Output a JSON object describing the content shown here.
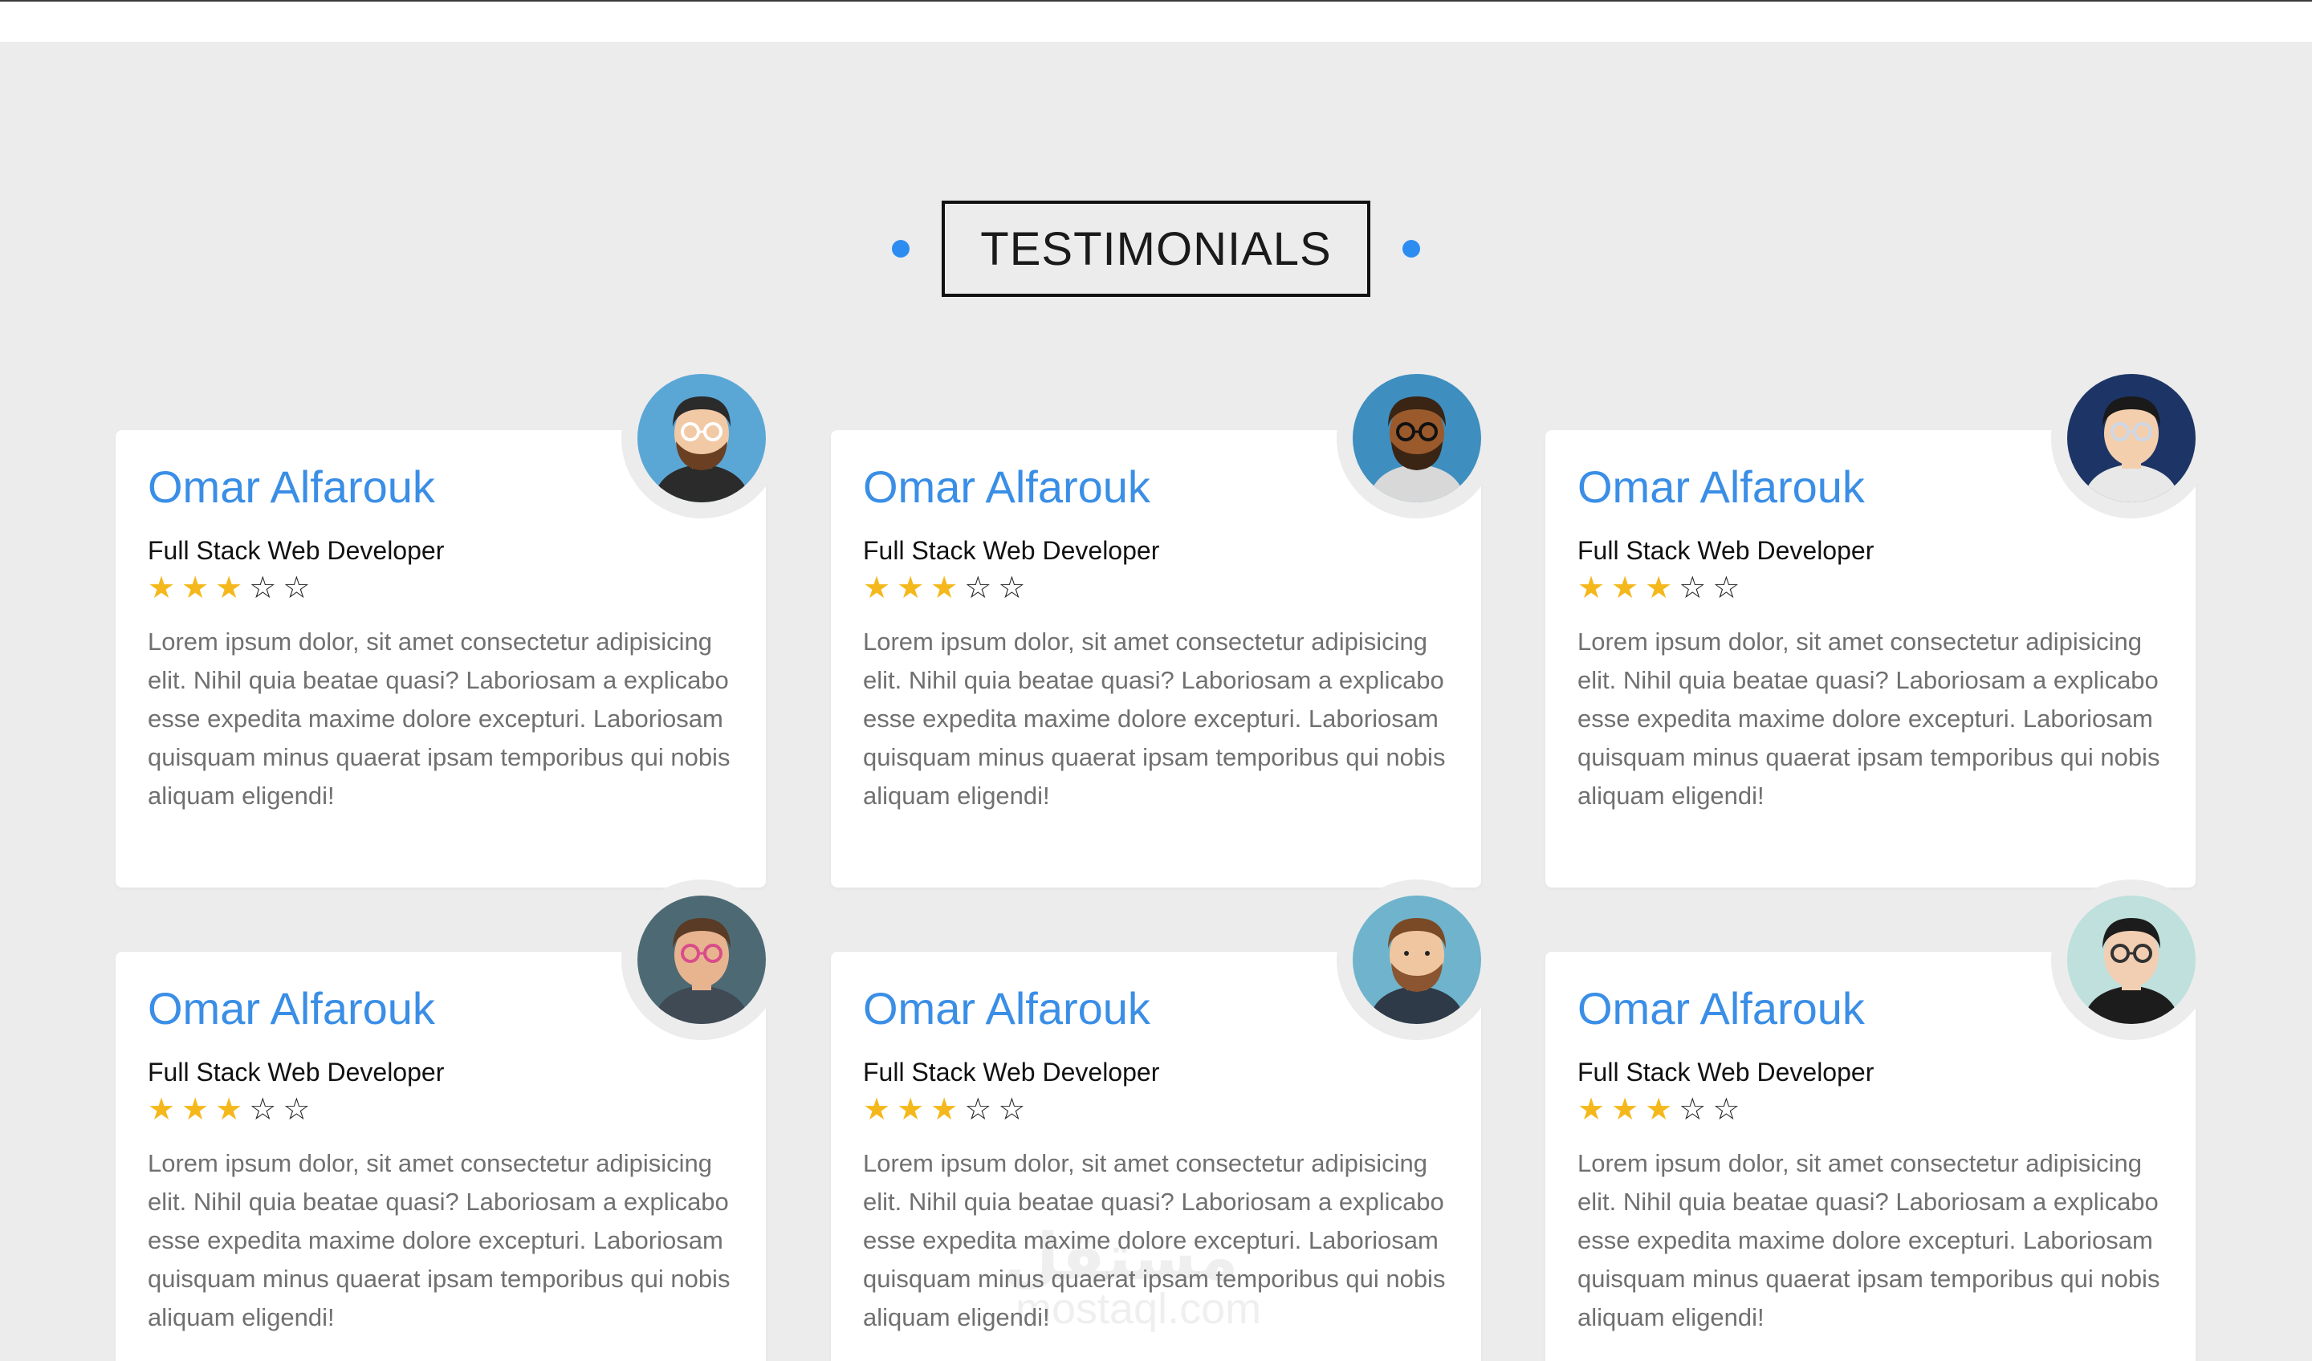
{
  "section": {
    "title": "TESTIMONIALS"
  },
  "colors": {
    "accent": "#2d8cf0",
    "name": "#3a8ee6",
    "star": "#f5b81c",
    "background": "#ececec"
  },
  "cards": [
    {
      "name": "Omar Alfarouk",
      "role": "Full Stack Web Developer",
      "rating": 3,
      "rating_max": 5,
      "text": "Lorem ipsum dolor, sit amet consectetur adipisicing elit. Nihil quia beatae quasi? Laboriosam a explicabo esse expedita maxime dolore excepturi. Laboriosam quisquam minus quaerat ipsam temporibus qui nobis aliquam eligendi!",
      "avatar": "avatar-bearded-glasses-icon"
    },
    {
      "name": "Omar Alfarouk",
      "role": "Full Stack Web Developer",
      "rating": 3,
      "rating_max": 5,
      "text": "Lorem ipsum dolor, sit amet consectetur adipisicing elit. Nihil quia beatae quasi? Laboriosam a explicabo esse expedita maxime dolore excepturi. Laboriosam quisquam minus quaerat ipsam temporibus qui nobis aliquam eligendi!",
      "avatar": "avatar-sunglasses-icon"
    },
    {
      "name": "Omar Alfarouk",
      "role": "Full Stack Web Developer",
      "rating": 3,
      "rating_max": 5,
      "text": "Lorem ipsum dolor, sit amet consectetur adipisicing elit. Nihil quia beatae quasi? Laboriosam a explicabo esse expedita maxime dolore excepturi. Laboriosam quisquam minus quaerat ipsam temporibus qui nobis aliquam eligendi!",
      "avatar": "avatar-glasses-icon"
    },
    {
      "name": "Omar Alfarouk",
      "role": "Full Stack Web Developer",
      "rating": 3,
      "rating_max": 5,
      "text": "Lorem ipsum dolor, sit amet consectetur adipisicing elit. Nihil quia beatae quasi? Laboriosam a explicabo esse expedita maxime dolore excepturi. Laboriosam quisquam minus quaerat ipsam temporibus qui nobis aliquam eligendi!",
      "avatar": "avatar-pink-glasses-icon"
    },
    {
      "name": "Omar Alfarouk",
      "role": "Full Stack Web Developer",
      "rating": 3,
      "rating_max": 5,
      "text": "Lorem ipsum dolor, sit amet consectetur adipisicing elit. Nihil quia beatae quasi? Laboriosam a explicabo esse expedita maxime dolore excepturi. Laboriosam quisquam minus quaerat ipsam temporibus qui nobis aliquam eligendi!",
      "avatar": "avatar-bearded-icon"
    },
    {
      "name": "Omar Alfarouk",
      "role": "Full Stack Web Developer",
      "rating": 3,
      "rating_max": 5,
      "text": "Lorem ipsum dolor, sit amet consectetur adipisicing elit. Nihil quia beatae quasi? Laboriosam a explicabo esse expedita maxime dolore excepturi. Laboriosam quisquam minus quaerat ipsam temporibus qui nobis aliquam eligendi!",
      "avatar": "avatar-aviator-icon"
    }
  ],
  "watermark": {
    "arabic": "مستقل",
    "latin": "mostaql.com"
  }
}
